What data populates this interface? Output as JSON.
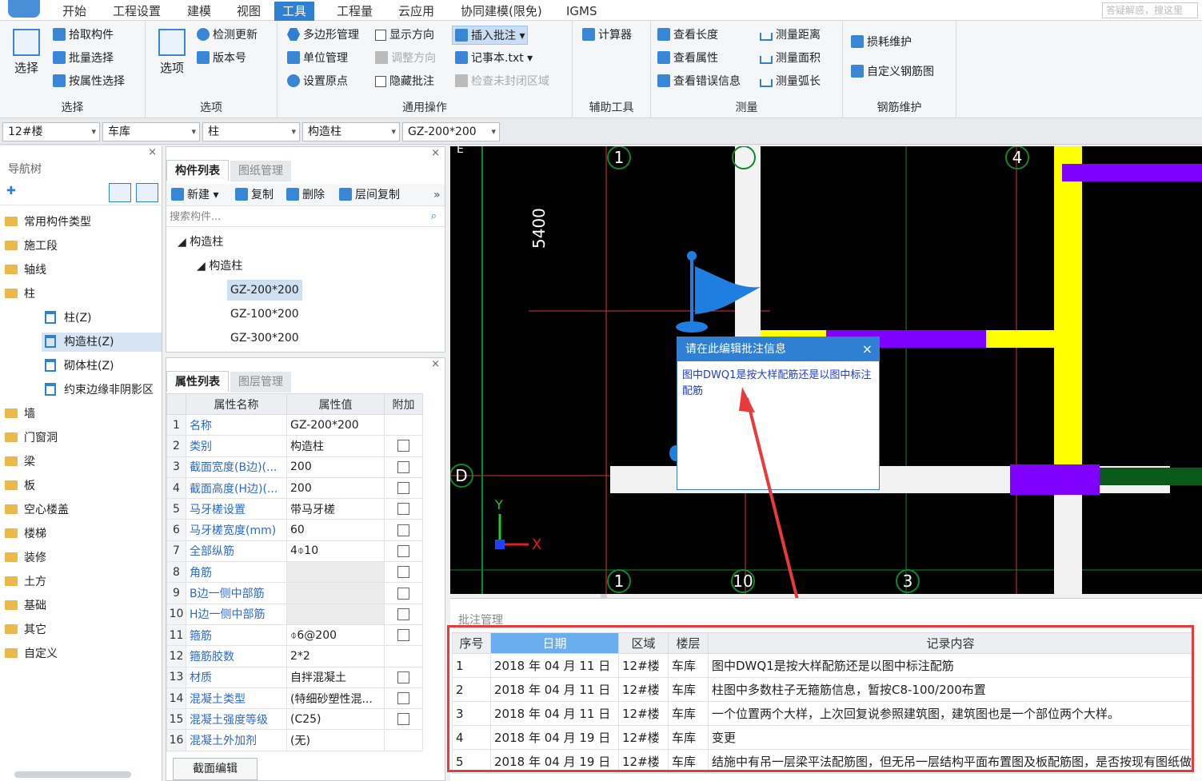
{
  "ribbon_tabs": [
    "开始",
    "工程设置",
    "建模",
    "视图",
    "工具",
    "工程量",
    "云应用",
    "协同建模(限免)",
    "IGMS"
  ],
  "active_tab": "工具",
  "search_placeholder": "答疑解惑，搜这里",
  "groups": {
    "select": {
      "label": "选择",
      "big": "选择",
      "items": [
        "拾取构件",
        "批量选择",
        "按属性选择"
      ]
    },
    "options": {
      "label": "选项",
      "big": "选项",
      "items": [
        "检测更新",
        "版本号"
      ]
    },
    "common": {
      "label": "通用操作",
      "items": [
        "多边形管理",
        "单位管理",
        "设置原点",
        "显示方向",
        "调整方向",
        "隐藏批注",
        "插入批注",
        "记事本.txt",
        "检查未封闭区域"
      ]
    },
    "aux": {
      "label": "辅助工具",
      "items": [
        "计算器"
      ]
    },
    "measure": {
      "label": "测量",
      "items": [
        "查看长度",
        "查看属性",
        "查看错误信息",
        "测量距离",
        "测量面积",
        "测量弧长"
      ]
    },
    "rebar": {
      "label": "钢筋维护",
      "items": [
        "损耗维护",
        "自定义钢筋图"
      ]
    }
  },
  "selectors": [
    "12#楼",
    "车库",
    "柱",
    "构造柱",
    "GZ-200*200"
  ],
  "nav": {
    "title": "导航树",
    "items": [
      "常用构件类型",
      "施工段",
      "轴线",
      "柱",
      "柱(Z)",
      "构造柱(Z)",
      "砌体柱(Z)",
      "约束边缘非阴影区",
      "墙",
      "门窗洞",
      "梁",
      "板",
      "空心楼盖",
      "楼梯",
      "装修",
      "土方",
      "基础",
      "其它",
      "自定义"
    ]
  },
  "component_panel": {
    "tabs": [
      "构件列表",
      "图纸管理"
    ],
    "tools": [
      "新建",
      "复制",
      "删除",
      "层间复制"
    ],
    "search_placeholder": "搜索构件...",
    "tree_root": "构造柱",
    "tree_child": "构造柱",
    "leaves": [
      "GZ-200*200",
      "GZ-100*200",
      "GZ-300*200"
    ]
  },
  "property_panel": {
    "tabs": [
      "属性列表",
      "图层管理"
    ],
    "headers": [
      "属性名称",
      "属性值",
      "附加"
    ],
    "rows": [
      {
        "n": "1",
        "name": "名称",
        "value": "GZ-200*200",
        "check": false
      },
      {
        "n": "2",
        "name": "类别",
        "value": "构造柱",
        "check": true
      },
      {
        "n": "3",
        "name": "截面宽度(B边)(...",
        "value": "200",
        "check": true
      },
      {
        "n": "4",
        "name": "截面高度(H边)(...",
        "value": "200",
        "check": true
      },
      {
        "n": "5",
        "name": "马牙槎设置",
        "value": "带马牙槎",
        "check": true
      },
      {
        "n": "6",
        "name": "马牙槎宽度(mm)",
        "value": "60",
        "check": true
      },
      {
        "n": "7",
        "name": "全部纵筋",
        "value": "4⌽10",
        "check": true
      },
      {
        "n": "8",
        "name": "角筋",
        "value": "",
        "check": true
      },
      {
        "n": "9",
        "name": "B边一侧中部筋",
        "value": "",
        "check": true
      },
      {
        "n": "10",
        "name": "H边一侧中部筋",
        "value": "",
        "check": true
      },
      {
        "n": "11",
        "name": "箍筋",
        "value": "⌽6@200",
        "check": true
      },
      {
        "n": "12",
        "name": "箍筋胶数",
        "value": "2*2",
        "check": false
      },
      {
        "n": "13",
        "name": "材质",
        "value": "自拌混凝土",
        "check": true
      },
      {
        "n": "14",
        "name": "混凝土类型",
        "value": "(特细砂塑性混...",
        "check": true
      },
      {
        "n": "15",
        "name": "混凝土强度等级",
        "value": "(C25)",
        "check": true
      },
      {
        "n": "16",
        "name": "混凝土外加剂",
        "value": "(无)",
        "check": false
      }
    ],
    "section_edit": "截面编辑"
  },
  "canvas": {
    "dimension": "5400",
    "axis_labels": [
      "1",
      "4",
      "D",
      "1",
      "10",
      "3"
    ],
    "axis_x": "X",
    "axis_y": "Y",
    "edge_label": "E"
  },
  "popup": {
    "title": "请在此编辑批注信息",
    "close": "×",
    "text": "图中DWQ1是按大样配筋还是以图中标注配筋"
  },
  "annotations": {
    "title": "批注管理",
    "headers": [
      "序号",
      "日期",
      "区域",
      "楼层",
      "记录内容"
    ],
    "rows": [
      {
        "n": "1",
        "date": "2018 年 04 月 11 日",
        "area": "12#楼",
        "floor": "车库",
        "content": "图中DWQ1是按大样配筋还是以图中标注配筋"
      },
      {
        "n": "2",
        "date": "2018 年 04 月 11 日",
        "area": "12#楼",
        "floor": "车库",
        "content": "柱图中多数柱子无箍筋信息，暂按C8-100/200布置"
      },
      {
        "n": "3",
        "date": "2018 年 04 月 11 日",
        "area": "12#楼",
        "floor": "车库",
        "content": "一个位置两个大样，上次回复说参照建筑图，建筑图也是一个部位两个大样。"
      },
      {
        "n": "4",
        "date": "2018 年 04 月 19 日",
        "area": "12#楼",
        "floor": "车库",
        "content": "变更"
      },
      {
        "n": "5",
        "date": "2018 年 04 月 19 日",
        "area": "12#楼",
        "floor": "车库",
        "content": "结施中有吊一层梁平法配筋图，但无吊一层结构平面布置图及板配筋图，是否按现有图纸做"
      }
    ]
  },
  "colors": {
    "accent": "#2f7fd3",
    "highlight": "#e83a3a",
    "wall": "#ffff00",
    "beam": "#8000ff"
  }
}
